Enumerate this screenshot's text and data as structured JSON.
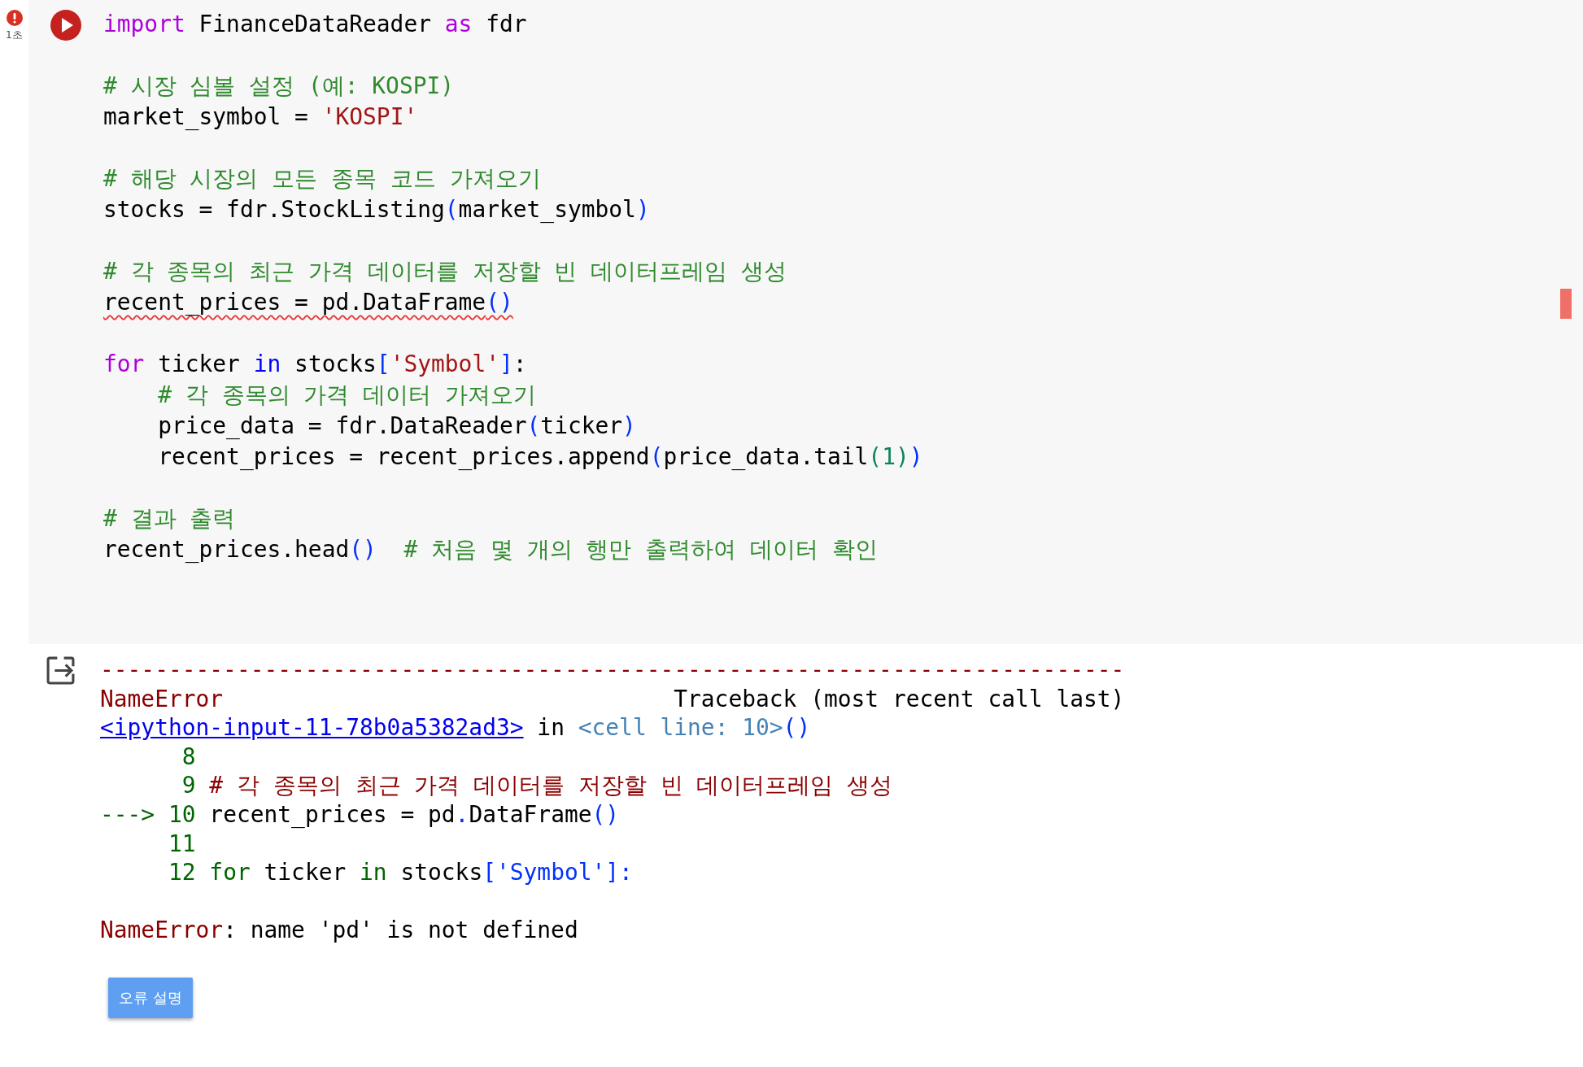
{
  "cell": {
    "error": true,
    "exec_time": "1초",
    "code_lines": [
      {
        "tokens": [
          {
            "t": "import",
            "kind": "kw"
          },
          {
            "t": " FinanceDataReader ",
            "kind": "plain"
          },
          {
            "t": "as",
            "kind": "kw"
          },
          {
            "t": " fdr",
            "kind": "plain"
          }
        ]
      },
      {
        "blank_before": true,
        "tokens": [
          {
            "t": "# 시장 심볼 설정 (예: KOSPI)",
            "kind": "comment"
          }
        ]
      },
      {
        "tokens": [
          {
            "t": "market_symbol = ",
            "kind": "plain"
          },
          {
            "t": "'KOSPI'",
            "kind": "str"
          }
        ]
      },
      {
        "blank_before": true,
        "tokens": [
          {
            "t": "# 해당 시장의 모든 종목 코드 가져오기",
            "kind": "comment"
          }
        ]
      },
      {
        "tokens": [
          {
            "t": "stocks = fdr.StockListing",
            "kind": "plain"
          },
          {
            "t": "(",
            "kind": "paren"
          },
          {
            "t": "market_symbol",
            "kind": "plain"
          },
          {
            "t": ")",
            "kind": "paren"
          }
        ]
      },
      {
        "blank_before": true,
        "tokens": [
          {
            "t": "# 각 종목의 최근 가격 데이터를 저장할 빈 데이터프레임 생성",
            "kind": "comment"
          }
        ]
      },
      {
        "squiggle": true,
        "tokens": [
          {
            "t": "recent_prices = pd.DataFrame",
            "kind": "plain"
          },
          {
            "t": "()",
            "kind": "paren"
          }
        ]
      },
      {
        "blank_before": true,
        "tokens": [
          {
            "t": "for",
            "kind": "kw"
          },
          {
            "t": " ticker ",
            "kind": "plain"
          },
          {
            "t": "in",
            "kind": "op"
          },
          {
            "t": " stocks",
            "kind": "plain"
          },
          {
            "t": "[",
            "kind": "paren"
          },
          {
            "t": "'Symbol'",
            "kind": "str"
          },
          {
            "t": "]",
            "kind": "paren"
          },
          {
            "t": ":",
            "kind": "plain"
          }
        ]
      },
      {
        "tokens": [
          {
            "t": "    # 각 종목의 가격 데이터 가져오기",
            "kind": "comment"
          }
        ]
      },
      {
        "tokens": [
          {
            "t": "    price_data = fdr.DataReader",
            "kind": "plain"
          },
          {
            "t": "(",
            "kind": "paren"
          },
          {
            "t": "ticker",
            "kind": "plain"
          },
          {
            "t": ")",
            "kind": "paren"
          }
        ]
      },
      {
        "tokens": [
          {
            "t": "    recent_prices = recent_prices.append",
            "kind": "plain"
          },
          {
            "t": "(",
            "kind": "paren"
          },
          {
            "t": "price_data.tail",
            "kind": "plain"
          },
          {
            "t": "(",
            "kind": "num"
          },
          {
            "t": "1",
            "kind": "num"
          },
          {
            "t": ")",
            "kind": "num"
          },
          {
            "t": ")",
            "kind": "paren"
          }
        ]
      },
      {
        "blank_before": true,
        "tokens": [
          {
            "t": "# 결과 출력",
            "kind": "comment"
          }
        ]
      },
      {
        "tokens": [
          {
            "t": "recent_prices.head",
            "kind": "plain"
          },
          {
            "t": "()",
            "kind": "paren"
          },
          {
            "t": "  # 처음 몇 개의 행만 출력하여 데이터 확인",
            "kind": "comment"
          }
        ]
      }
    ],
    "output_lines": [
      {
        "tokens": [
          {
            "t": "---------------------------------------------------------------------------",
            "kind": "rule"
          }
        ]
      },
      {
        "tokens": [
          {
            "t": "NameError",
            "kind": "ename"
          },
          {
            "t": "                                 Traceback (most recent call last)",
            "kind": "plain"
          }
        ]
      },
      {
        "tokens": [
          {
            "t": "<ipython-input-11-78b0a5382ad3>",
            "kind": "link"
          },
          {
            "t": " in ",
            "kind": "plain"
          },
          {
            "t": "<cell line: 10>",
            "kind": "cellref"
          },
          {
            "t": "()",
            "kind": "paren"
          }
        ]
      },
      {
        "tokens": [
          {
            "t": "      8",
            "kind": "lineno"
          }
        ]
      },
      {
        "tokens": [
          {
            "t": "      9 ",
            "kind": "lineno"
          },
          {
            "t": "# 각 종목의 최근 가격 데이터를 저장할 빈 데이터프레임 생성",
            "kind": "ename"
          }
        ]
      },
      {
        "tokens": [
          {
            "t": "---> 10 ",
            "kind": "lineno"
          },
          {
            "t": "recent_prices = pd",
            "kind": "plain"
          },
          {
            "t": ".",
            "kind": "paren"
          },
          {
            "t": "DataFrame",
            "kind": "plain"
          },
          {
            "t": "()",
            "kind": "paren"
          }
        ]
      },
      {
        "tokens": [
          {
            "t": "     11",
            "kind": "lineno"
          }
        ]
      },
      {
        "tokens": [
          {
            "t": "     12 ",
            "kind": "lineno"
          },
          {
            "t": "for",
            "kind": "lineno"
          },
          {
            "t": " ticker ",
            "kind": "plain"
          },
          {
            "t": "in",
            "kind": "lineno"
          },
          {
            "t": " stocks",
            "kind": "plain"
          },
          {
            "t": "['Symbol']:",
            "kind": "paren"
          }
        ]
      },
      {
        "blank_before": true,
        "tokens": [
          {
            "t": "NameError",
            "kind": "ename"
          },
          {
            "t": ": name 'pd' is not defined",
            "kind": "plain"
          }
        ]
      }
    ],
    "explain_button": "오류 설명"
  }
}
